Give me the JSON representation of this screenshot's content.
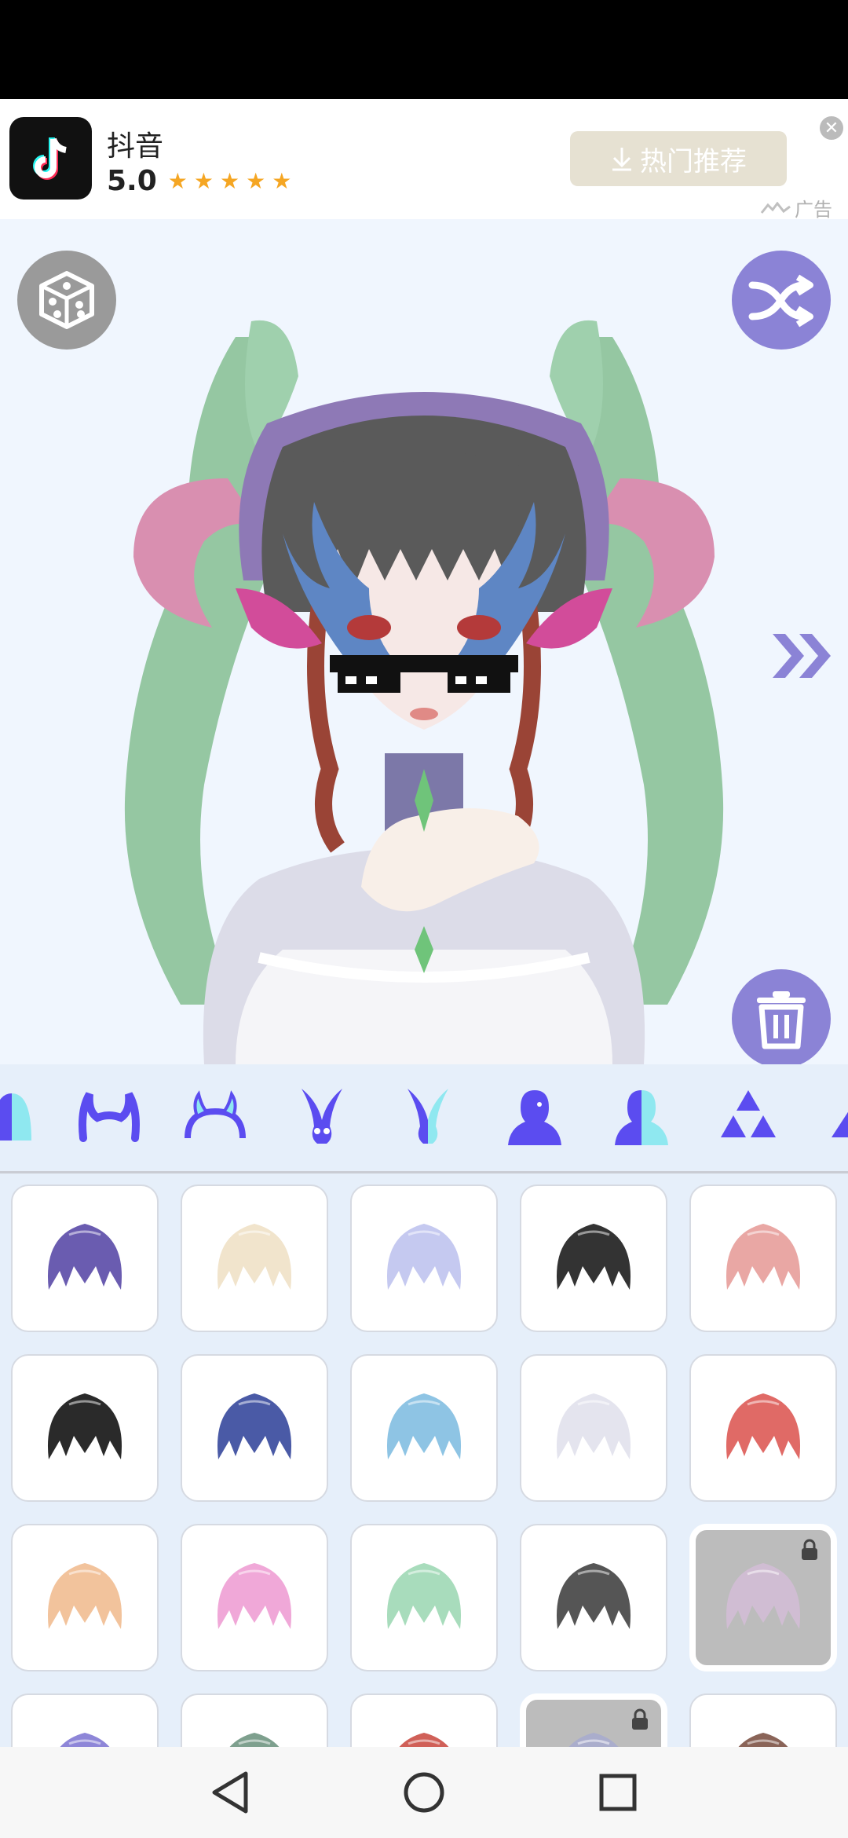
{
  "ad": {
    "app_name": "抖音",
    "rating": "5.0",
    "stars": "★★★★★",
    "button_label": "热门推荐",
    "tag": "广告"
  },
  "icons": {
    "dice": "dice-icon",
    "shuffle": "shuffle-icon",
    "next": "double-chevron-right-icon",
    "trash": "trash-icon",
    "lock": "lock-icon"
  },
  "categories": [
    "split-ear-icon",
    "demon-horns-icon",
    "outline-horns-icon",
    "bunny-ears-icon",
    "split-bunny-ears-icon",
    "silhouette-icon",
    "split-silhouette-icon",
    "triangles-icon",
    "triangle-icon"
  ],
  "hair_tiles": [
    {
      "color": "#6a5cb0",
      "locked": false
    },
    {
      "color": "#f1e4cc",
      "locked": false
    },
    {
      "color": "#c5c9f0",
      "locked": false
    },
    {
      "color": "#333333",
      "locked": false
    },
    {
      "color": "#e9a7a4",
      "locked": false
    },
    {
      "color": "#2a2a2a",
      "locked": false
    },
    {
      "color": "#4a5aa6",
      "locked": false
    },
    {
      "color": "#8ec4e4",
      "locked": false
    },
    {
      "color": "#e4e4ee",
      "locked": false
    },
    {
      "color": "#e06a66",
      "locked": false
    },
    {
      "color": "#f2c39c",
      "locked": false
    },
    {
      "color": "#f0a8d8",
      "locked": false
    },
    {
      "color": "#a8dcbc",
      "locked": false
    },
    {
      "color": "#555555",
      "locked": false
    },
    {
      "color": "#e0bde6",
      "locked": true
    },
    {
      "color": "#8e86d8",
      "locked": false
    },
    {
      "color": "#7ea08e",
      "locked": false
    },
    {
      "color": "#d06058",
      "locked": false
    },
    {
      "color": "#9aa0d8",
      "locked": true
    },
    {
      "color": "#8a6458",
      "locked": false
    }
  ],
  "colors": {
    "accent": "#8b83d6",
    "category_icon": "#5b4cf0",
    "category_accent": "#8fe8f0"
  }
}
